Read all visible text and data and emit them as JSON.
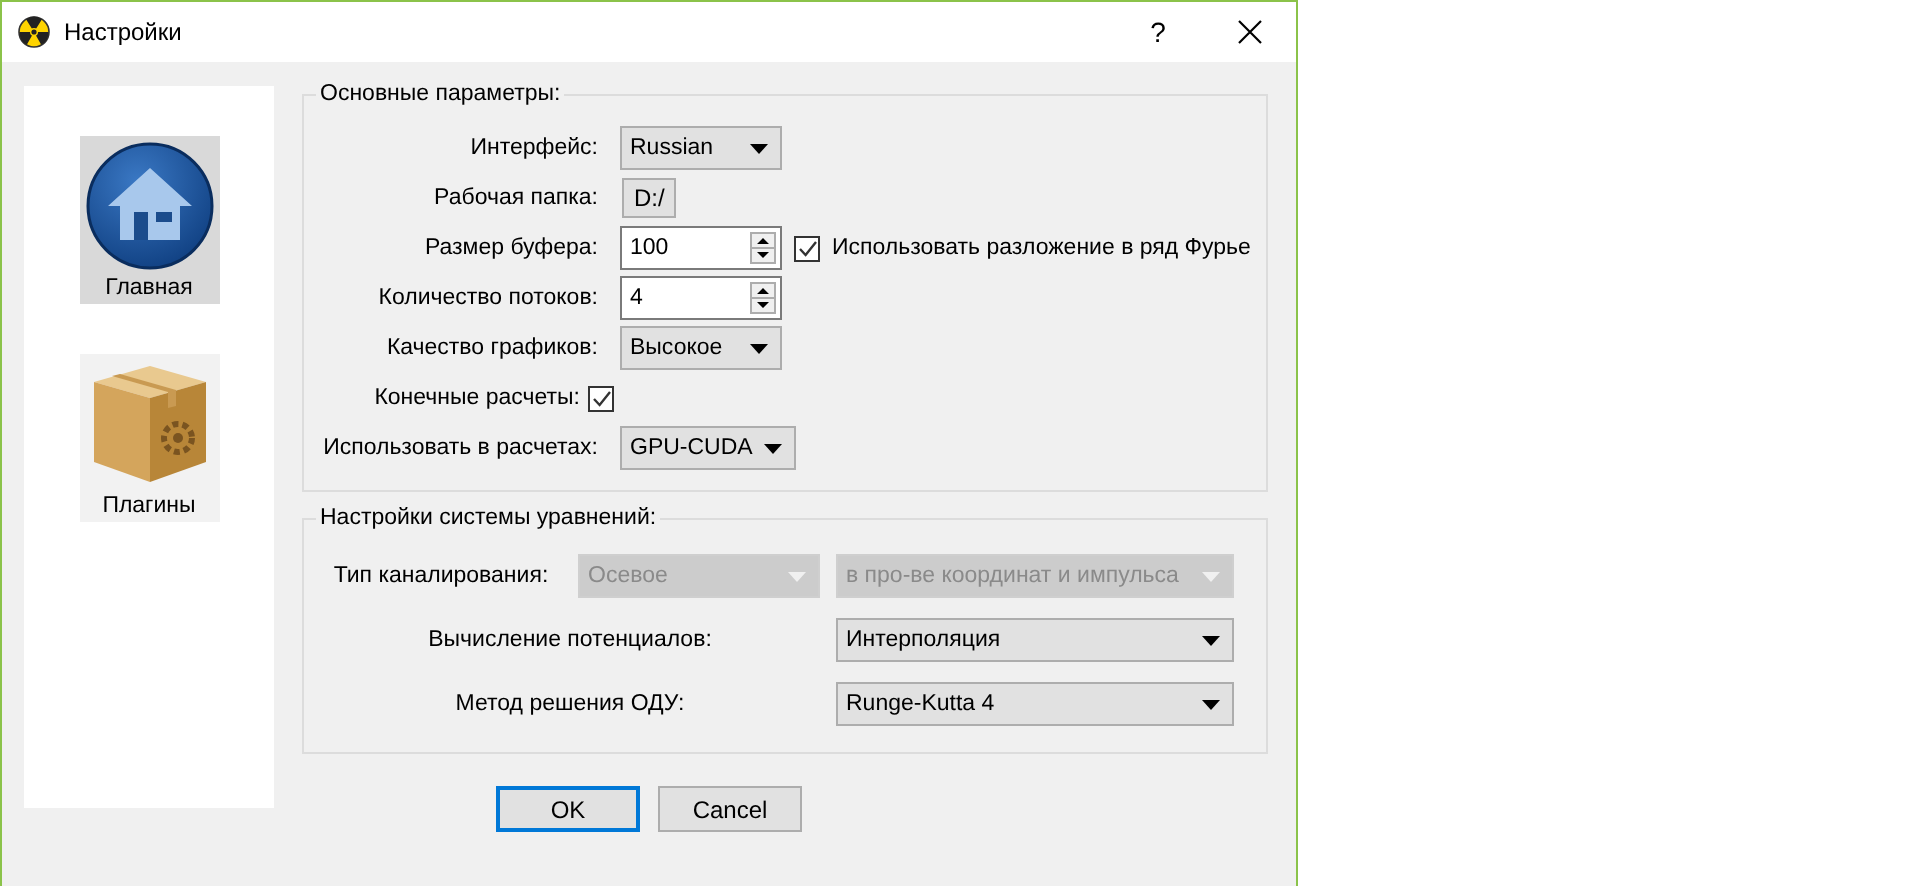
{
  "window": {
    "title": "Настройки",
    "help_button": "?"
  },
  "sidebar": {
    "items": [
      {
        "label": "Главная",
        "kind": "home",
        "selected": true
      },
      {
        "label": "Плагины",
        "kind": "package",
        "selected": false
      }
    ]
  },
  "main_group": {
    "title": "Основные параметры:",
    "rows": [
      {
        "label": "Интерфейс:",
        "kind": "combo",
        "value": "Russian"
      },
      {
        "label": "Рабочая папка:",
        "kind": "folder",
        "value": "D:/"
      },
      {
        "label": "Размер буфера:",
        "kind": "spin",
        "value": "100",
        "extra_checkbox": {
          "label": "Использовать разложение в ряд Фурье",
          "checked": true
        }
      },
      {
        "label": "Количество потоков:",
        "kind": "spin",
        "value": "4"
      },
      {
        "label": "Качество графиков:",
        "kind": "combo",
        "value": "Высокое"
      },
      {
        "label": "Конечные расчеты:",
        "kind": "checkbox",
        "checked": true
      },
      {
        "label": "Использовать в расчетах:",
        "kind": "combo",
        "value": "GPU-CUDA"
      }
    ]
  },
  "equations_group": {
    "title": "Настройки системы уравнений:",
    "rows": [
      {
        "label": "Тип каналирования:",
        "controls": [
          {
            "value": "Осевое",
            "disabled": true
          },
          {
            "value": "в про-ве координат и импульса",
            "disabled": true
          }
        ]
      },
      {
        "label": "Вычисление потенциалов:",
        "controls": [
          {
            "value": "Интерполяция",
            "disabled": false
          }
        ]
      },
      {
        "label": "Метод решения ОДУ:",
        "controls": [
          {
            "value": "Runge-Kutta 4",
            "disabled": false
          }
        ]
      }
    ]
  },
  "buttons": [
    {
      "label": "OK",
      "focused": true
    },
    {
      "label": "Cancel",
      "focused": false
    }
  ]
}
